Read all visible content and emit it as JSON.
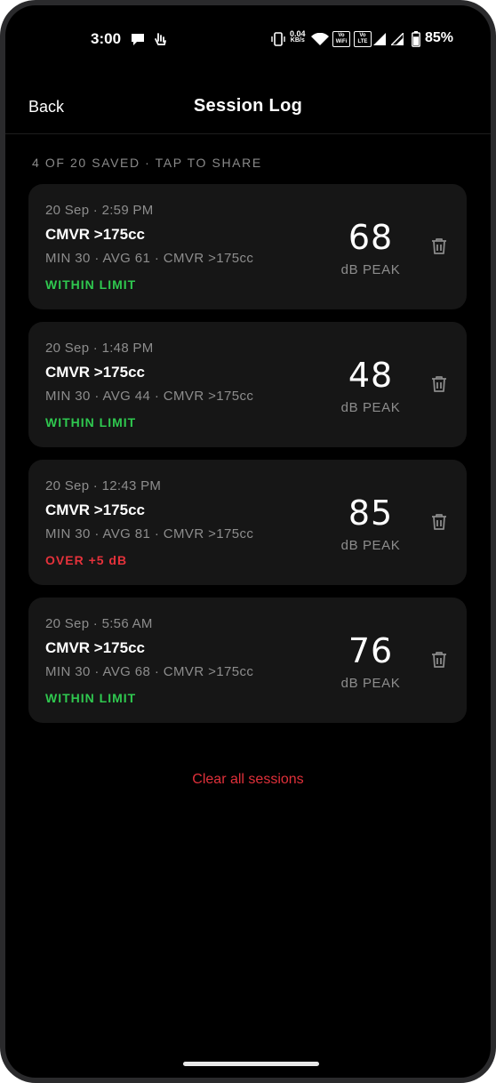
{
  "status_bar": {
    "time": "3:00",
    "net_speed_value": "0.04",
    "net_speed_unit": "KB/s",
    "sim1_top": "Vo",
    "sim1_bottom": "WiFi",
    "sim2_top": "Vo",
    "sim2_bottom": "LTE",
    "battery": "85%",
    "battery_level": 0.85
  },
  "header": {
    "back_label": "Back",
    "title": "Session Log"
  },
  "counter_text": "4 OF 20 SAVED · TAP TO SHARE",
  "sessions": [
    {
      "date": "20 Sep · 2:59 PM",
      "name": "CMVR >175cc",
      "stats": "MIN 30 · AVG 61 · CMVR >175cc",
      "status": "WITHIN LIMIT",
      "peak": "68",
      "unit": "dB PEAK"
    },
    {
      "date": "20 Sep · 1:48 PM",
      "name": "CMVR >175cc",
      "stats": "MIN 30 · AVG 44 · CMVR >175cc",
      "status": "WITHIN LIMIT",
      "peak": "48",
      "unit": "dB PEAK"
    },
    {
      "date": "20 Sep · 12:43 PM",
      "name": "CMVR >175cc",
      "stats": "MIN 30 · AVG 81 · CMVR >175cc",
      "status": "OVER +5 dB",
      "peak": "85",
      "unit": "dB PEAK"
    },
    {
      "date": "20 Sep · 5:56 AM",
      "name": "CMVR >175cc",
      "stats": "MIN 30 · AVG 68 · CMVR >175cc",
      "status": "WITHIN LIMIT",
      "peak": "76",
      "unit": "dB PEAK"
    }
  ],
  "clear_label": "Clear all sessions",
  "colors": {
    "ok": "#2fc84f",
    "over": "#e5323b",
    "clear": "#e0303a",
    "card_bg": "#161616"
  },
  "icons": {
    "trash": "trash-icon",
    "wifi": "wifi-icon",
    "signal": "signal-icon",
    "battery": "battery-icon"
  }
}
